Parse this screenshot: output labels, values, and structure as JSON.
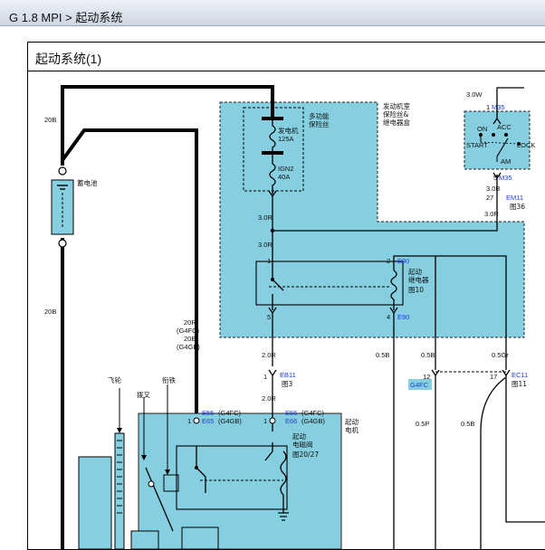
{
  "breadcrumb": "G 1.8 MPI > 起动系统",
  "section_title": "起动系统(1)",
  "labels": {
    "w20b_top": "20B",
    "w20b_mid": "20B",
    "battery": "蓄电池",
    "fuse_box_title": "多功能\n保险丝",
    "gen_fuse": "发电机\n125A",
    "ign2_fuse": "IGN2\n40A",
    "engine_room_box": "发动机室\n保险丝&\n继电器盒",
    "w30r_1": "3.0R",
    "w30r_2": "3.0R",
    "w30w": "3.0W",
    "pin1_m35": "1",
    "m35_top": "M35",
    "sw_on": "ON",
    "sw_acc": "ACC",
    "sw_start": "START",
    "sw_lock": "LOCK",
    "sw_am": "AM",
    "pin5_m35": "5",
    "m35_bot": "M35",
    "w30b": "3.0B",
    "pin27": "27",
    "em11": "EM11",
    "fig36": "图36",
    "w30r_3": "3.0R",
    "pin1_relay": "1",
    "pin2_relay": "2",
    "e90_top": "E90",
    "relay_name": "起动\n继电器",
    "fig10": "图10",
    "pin5_relay": "5",
    "pin4_relay": "4",
    "e90_bot": "E90",
    "w20r_label": "20R\n(G4FC)\n20B\n(G4GB)",
    "w20r": "2.0R",
    "w05b_1": "0.5B",
    "w05b_2": "0.5B",
    "w05gr": "0.5Gr",
    "pin1_eb11": "1",
    "eb11": "EB11",
    "fig3": "图3",
    "pin12": "12",
    "pin17": "17",
    "ec11": "EC11",
    "fig11": "图11",
    "g4fc": "G4FC",
    "flywheel": "飞轮",
    "armature": "衔铁",
    "fork": "拨叉",
    "w20r_2": "2.0R",
    "starter_motor": "起动\n电机",
    "e55": "E55",
    "e55_tag": "(G4FC)",
    "e65": "E65",
    "e65_tag": "(G4GB)",
    "pin1_e55": "1",
    "e56": "E56",
    "e56_tag": "(G4FC)",
    "e66": "E66",
    "e66_tag": "(G4GB)",
    "pin1_e56": "1",
    "solenoid": "起动\n电磁阀",
    "fig20_27": "图20/27",
    "w05p": "0.5P",
    "w05b_3": "0.5B"
  },
  "colors": {
    "panel": "#86cfe0",
    "panel_edge": "#333333",
    "connector_text": "#1d3fd0",
    "g4fc_badge": "#86cfe0"
  }
}
